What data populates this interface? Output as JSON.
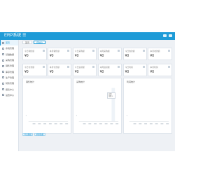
{
  "header": {
    "title": "ERP系统",
    "menu_glyph": "☰"
  },
  "sidebar": {
    "items": [
      {
        "label": "首页"
      },
      {
        "label": "系统管理"
      },
      {
        "label": "基础数据"
      },
      {
        "label": "采购管理"
      },
      {
        "label": "销售管理"
      },
      {
        "label": "库存管理"
      },
      {
        "label": "生产管理"
      },
      {
        "label": "财务管理"
      },
      {
        "label": "报表中心"
      },
      {
        "label": "设置中心"
      }
    ]
  },
  "tabs": [
    {
      "label": "首页"
    },
    {
      "label": "控制台"
    }
  ],
  "stats": [
    {
      "label": "今日销售额",
      "value": "¥0"
    },
    {
      "label": "本月销售额",
      "value": "¥0"
    },
    {
      "label": "今日采购额",
      "value": "¥0"
    },
    {
      "label": "本月采购额",
      "value": "¥0"
    },
    {
      "label": "今日收款额",
      "value": "¥0"
    },
    {
      "label": "本月收款额",
      "value": "¥0"
    },
    {
      "label": "今日付款额",
      "value": "¥0"
    },
    {
      "label": "本月付款额",
      "value": "¥0"
    },
    {
      "label": "今日退货额",
      "value": "¥0"
    },
    {
      "label": "本月退货额",
      "value": "¥0"
    },
    {
      "label": "今日利润",
      "value": "¥0"
    },
    {
      "label": "本月利润",
      "value": "¥0"
    }
  ],
  "panels": [
    {
      "title": "销售统计"
    },
    {
      "title": "采购统计"
    },
    {
      "title": "利润统计"
    }
  ],
  "tooltip": {
    "line1": "日期",
    "line2": "金额 0"
  },
  "bottom": {
    "buttons": [
      {
        "label": "导出数据"
      },
      {
        "label": "刷新数据"
      }
    ]
  },
  "colors": {
    "primary": "#1e9bd7",
    "frame_bg": "#eef1f5"
  }
}
